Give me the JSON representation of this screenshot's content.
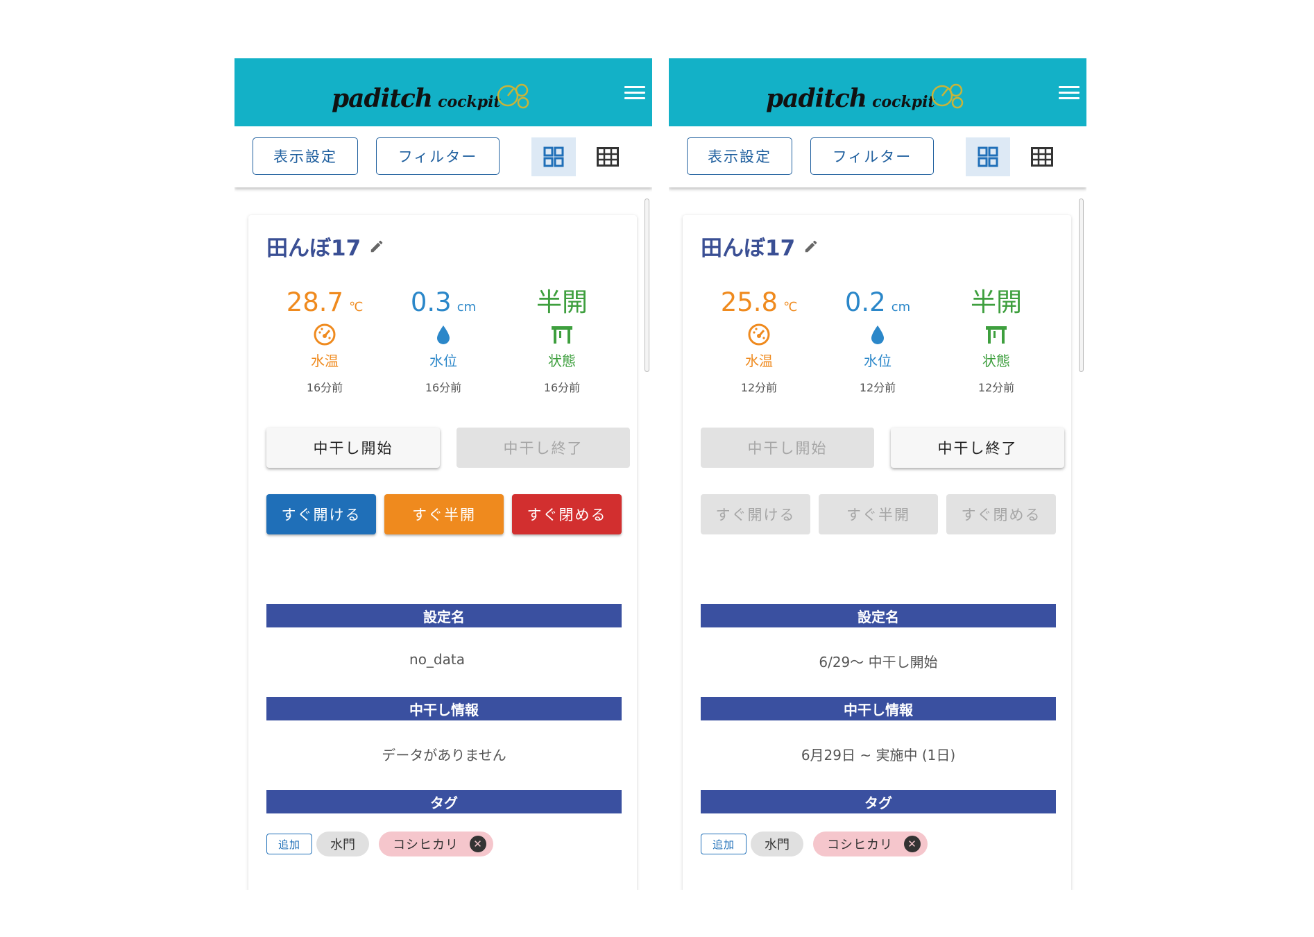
{
  "app": {
    "logo_main": "paditch",
    "logo_sub": "cockpit"
  },
  "toolbar": {
    "display_settings": "表示設定",
    "filter": "フィルター"
  },
  "colors": {
    "header": "#13b1c7",
    "section": "#3a50a0",
    "temp": "#ef8a1e",
    "level": "#2b87c9",
    "state": "#3e9f3e",
    "open": "#1f6fb8",
    "half": "#ef8a1e",
    "close": "#d22f2f",
    "tag_variety": "#f5c6cc"
  },
  "icons": {
    "menu": "hamburger-menu-icon",
    "grid_view": "grid-view-icon",
    "table_view": "table-view-icon",
    "edit": "pencil-icon",
    "temperature": "gauge-icon",
    "water_level": "water-drop-icon",
    "gate_state": "gate-icon",
    "remove_tag": "close-circle-icon"
  },
  "left": {
    "field_name": "田んぼ17",
    "temp": {
      "value": "28.7",
      "unit": "℃",
      "label": "水温",
      "time": "16分前"
    },
    "level": {
      "value": "0.3",
      "unit": "cm",
      "label": "水位",
      "time": "16分前"
    },
    "state": {
      "value": "半開",
      "label": "状態",
      "time": "16分前"
    },
    "midseason": {
      "start": "中干し開始",
      "end": "中干し終了"
    },
    "quick": {
      "open": "すぐ開ける",
      "half": "すぐ半開",
      "close": "すぐ閉める"
    },
    "sections": {
      "setting_name_head": "設定名",
      "setting_name_value": "no_data",
      "midseason_head": "中干し情報",
      "midseason_value": "データがありません",
      "tag_head": "タグ"
    },
    "tags": {
      "add": "追加",
      "gate": "水門",
      "variety": "コシヒカリ"
    }
  },
  "right": {
    "field_name": "田んぼ17",
    "temp": {
      "value": "25.8",
      "unit": "℃",
      "label": "水温",
      "time": "12分前"
    },
    "level": {
      "value": "0.2",
      "unit": "cm",
      "label": "水位",
      "time": "12分前"
    },
    "state": {
      "value": "半開",
      "label": "状態",
      "time": "12分前"
    },
    "midseason": {
      "start": "中干し開始",
      "end": "中干し終了"
    },
    "quick": {
      "open": "すぐ開ける",
      "half": "すぐ半開",
      "close": "すぐ閉める"
    },
    "sections": {
      "setting_name_head": "設定名",
      "setting_name_value": "6/29～ 中干し開始",
      "midseason_head": "中干し情報",
      "midseason_value": "6月29日 ~ 実施中 (1日)",
      "tag_head": "タグ"
    },
    "tags": {
      "add": "追加",
      "gate": "水門",
      "variety": "コシヒカリ"
    }
  }
}
